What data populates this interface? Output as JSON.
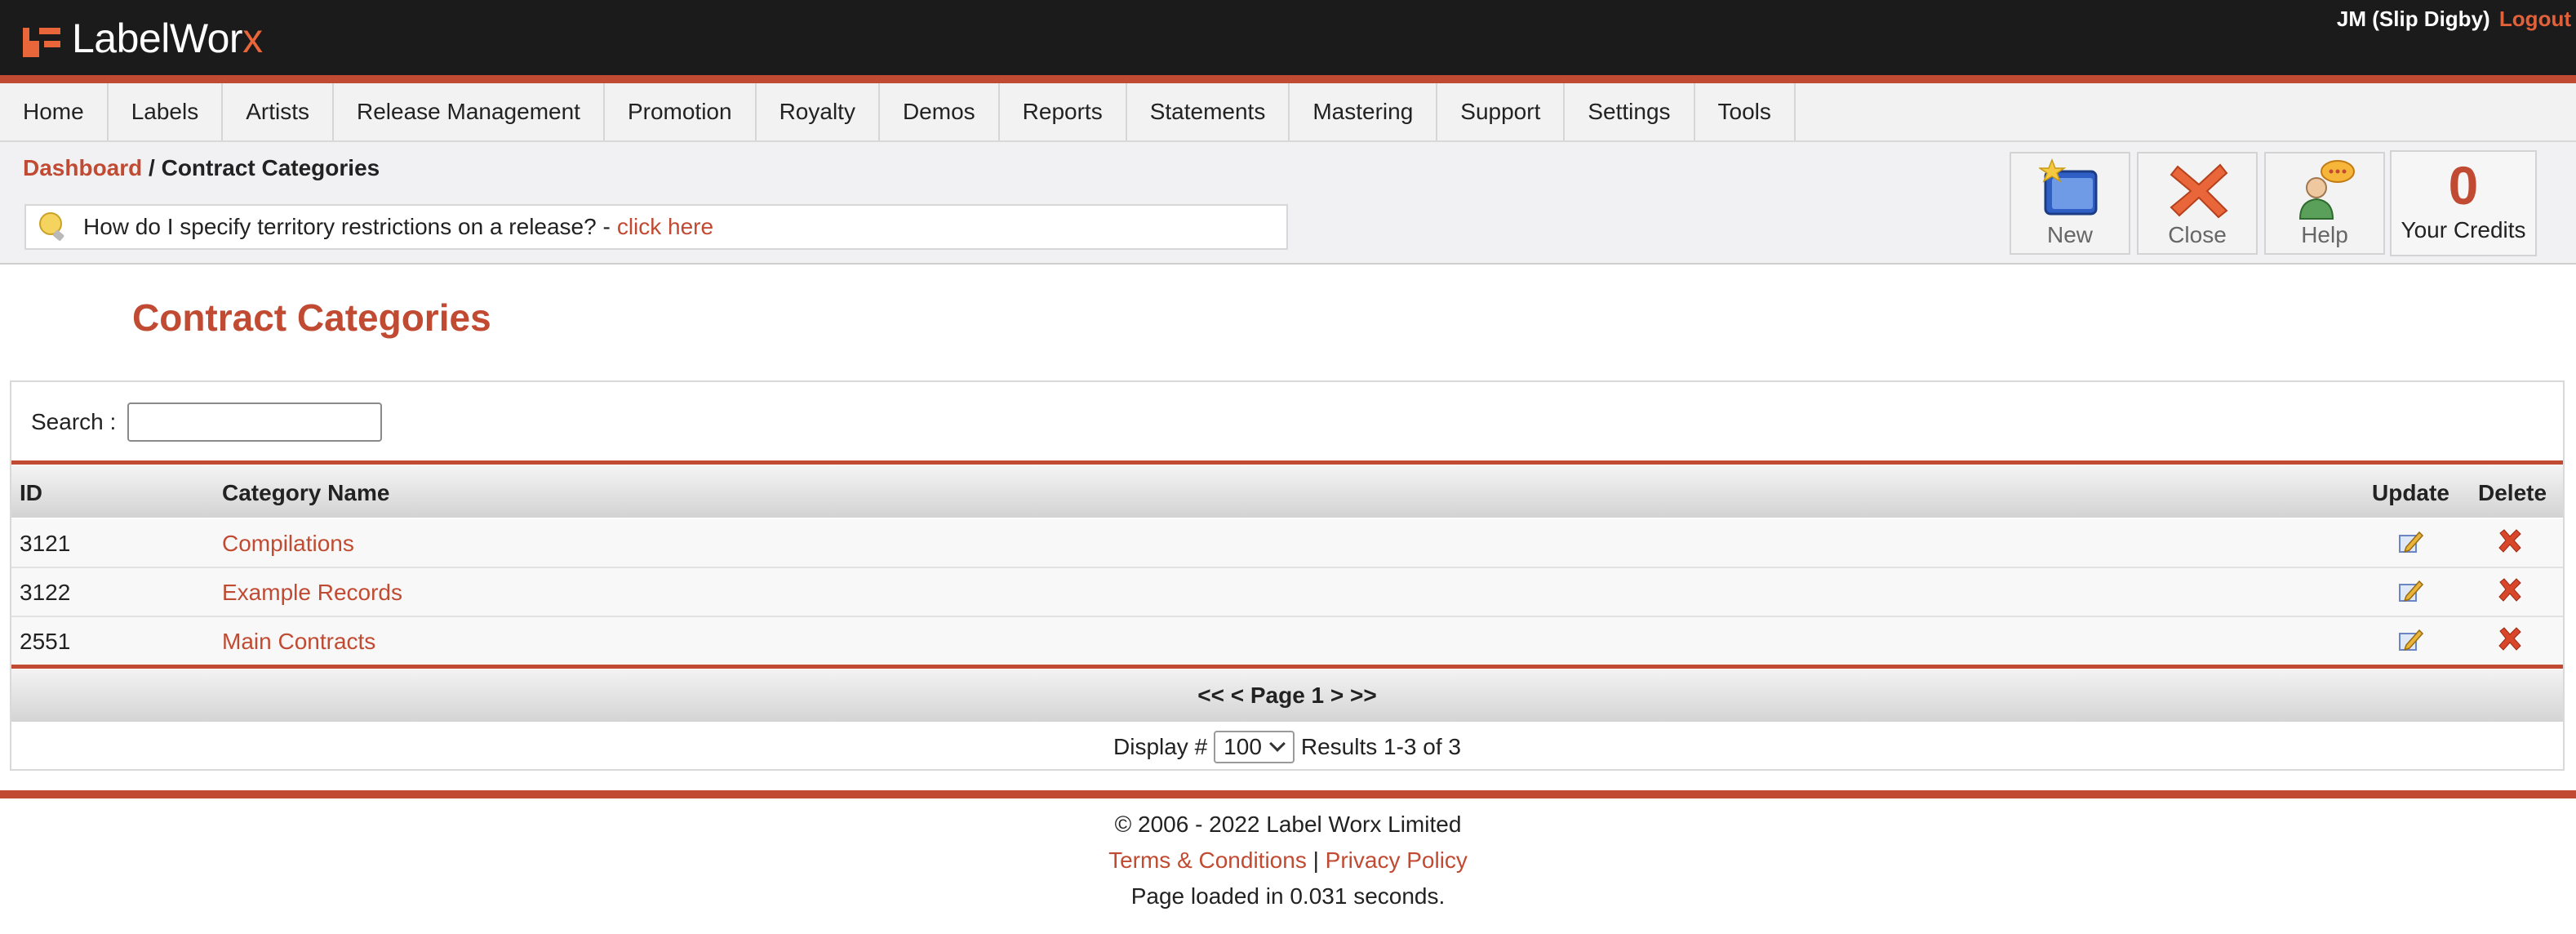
{
  "header": {
    "logo_text": "LabelWor",
    "logo_x": "x",
    "user": "JM (Slip Digby)",
    "logout": "Logout"
  },
  "nav": [
    {
      "label": "Home"
    },
    {
      "label": "Labels"
    },
    {
      "label": "Artists"
    },
    {
      "label": "Release Management"
    },
    {
      "label": "Promotion"
    },
    {
      "label": "Royalty"
    },
    {
      "label": "Demos"
    },
    {
      "label": "Reports"
    },
    {
      "label": "Statements"
    },
    {
      "label": "Mastering"
    },
    {
      "label": "Support"
    },
    {
      "label": "Settings"
    },
    {
      "label": "Tools"
    }
  ],
  "breadcrumb": {
    "root": "Dashboard",
    "separator": " / ",
    "current": "Contract Categories"
  },
  "tip": {
    "text": "How do I specify territory restrictions on a release? -",
    "link": "click here"
  },
  "toolbar": {
    "new_label": "New",
    "close_label": "Close",
    "help_label": "Help",
    "credits_value": "0",
    "credits_label": "Your Credits"
  },
  "page_title": "Contract Categories",
  "search": {
    "label": "Search :",
    "value": ""
  },
  "table": {
    "headers": {
      "id": "ID",
      "name": "Category Name",
      "update": "Update",
      "delete": "Delete"
    },
    "rows": [
      {
        "id": "3121",
        "name": "Compilations"
      },
      {
        "id": "3122",
        "name": "Example Records"
      },
      {
        "id": "2551",
        "name": "Main Contracts"
      }
    ]
  },
  "pager": {
    "text": "<< < Page 1 > >>"
  },
  "display": {
    "label": "Display #",
    "selected": "100",
    "results": "Results 1-3 of 3"
  },
  "footer": {
    "copyright": "© 2006 - 2022 Label Worx Limited",
    "terms": "Terms & Conditions",
    "separator": " | ",
    "privacy": "Privacy Policy",
    "loaded": "Page loaded in 0.031 seconds."
  },
  "colors": {
    "brand": "#c14b32",
    "header_bg": "#1b1b1b"
  }
}
